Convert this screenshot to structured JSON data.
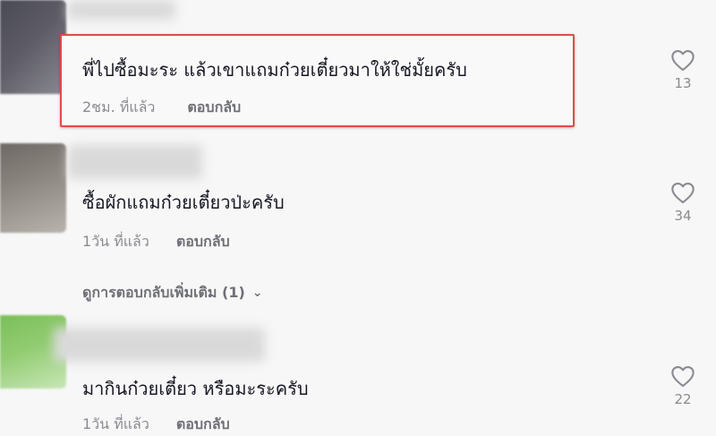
{
  "comments": [
    {
      "text": "พี่ไปซื้อมะระ แล้วเขาแถมก๋วยเตี๋ยวมาให้ใช่มั้ยครับ",
      "time": "2ชม. ที่แล้ว",
      "reply_label": "ตอบกลับ",
      "likes": "13",
      "highlighted": true
    },
    {
      "text": "ซื้อผักแถมก๋วยเตี๋ยวป่ะครับ",
      "time": "1วัน ที่แล้ว",
      "reply_label": "ตอบกลับ",
      "likes": "34",
      "view_more_label": "ดูการตอบกลับเพิ่มเติม (1)"
    },
    {
      "text": "มากินก๋วยเตี๋ยว หรือมะระครับ",
      "time": "1วัน ที่แล้ว",
      "reply_label": "ตอบกลับ",
      "likes": "22"
    }
  ],
  "colors": {
    "highlight_border": "#e24a4a",
    "text": "#161823",
    "muted": "#8a8b91",
    "background": "#f7f7f7"
  },
  "icons": {
    "like": "heart-outline-icon",
    "expand": "chevron-down-icon"
  }
}
